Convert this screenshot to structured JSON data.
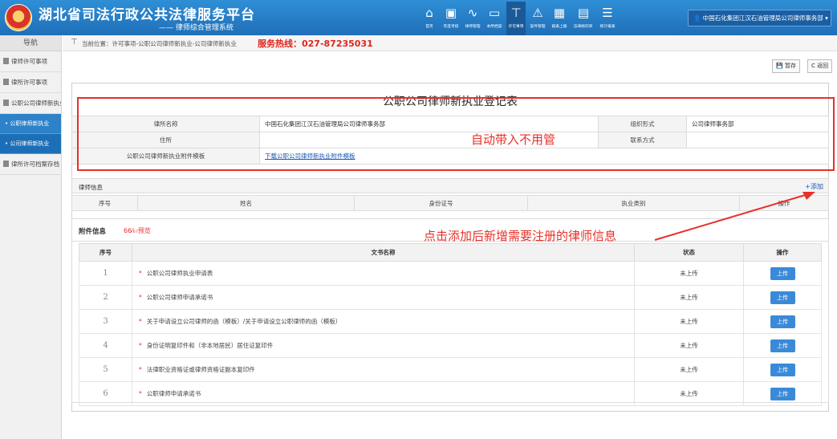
{
  "header": {
    "title": "湖北省司法行政公共法律服务平台",
    "subtitle": "—— 律师综合管理系统",
    "nav": [
      {
        "label": "首页",
        "icon": "home-icon",
        "glyph": "⌂"
      },
      {
        "label": "年度考核",
        "icon": "briefcase-icon",
        "glyph": "▣"
      },
      {
        "label": "律师管理",
        "icon": "pulse-icon",
        "glyph": "∿"
      },
      {
        "label": "本所档案",
        "icon": "monitor-icon",
        "glyph": "▭"
      },
      {
        "label": "许可事项",
        "icon": "sitemap-icon",
        "glyph": "⊤"
      },
      {
        "label": "案件管理",
        "icon": "warning-icon",
        "glyph": "⚠"
      },
      {
        "label": "报表上报",
        "icon": "report-icon",
        "glyph": "▦"
      },
      {
        "label": "法律顾问单",
        "icon": "document-icon",
        "glyph": "▤"
      },
      {
        "label": "统计报表",
        "icon": "list-icon",
        "glyph": "☰"
      }
    ],
    "user": "中国石化集团江汉石油管理局公司律师事务部 ▾"
  },
  "sidebar": {
    "title": "导航",
    "items": [
      {
        "label": "律师许可事项"
      },
      {
        "label": "律所许可事项"
      },
      {
        "label": "公职公司律师新执业"
      }
    ],
    "subitems": [
      {
        "label": "公职律师新执业"
      },
      {
        "label": "公司律师新执业"
      }
    ],
    "last_item": "律所许可档案存档"
  },
  "breadcrumb": {
    "icon": "sitemap-icon",
    "text": "当前位置：许可事项-公职公司律师新执业-公司律师新执业",
    "hotline": "服务热线：027-87235031"
  },
  "toolbar": {
    "save": "💾 暂存",
    "back": "C 返回"
  },
  "form": {
    "title": "公职公司律师新执业登记表",
    "rows": {
      "name_label": "律所名称",
      "name_value": "中国石化集团江汉石油管理局公司律师事务部",
      "org_label": "组织形式",
      "org_value": "公司律师事务部",
      "address_label": "住所",
      "address_value": "",
      "contact_label": "联系方式",
      "contact_value": "",
      "template_label": "公职公司律师新执业附件模板",
      "template_link": "下载公职公司律师新执业附件模板"
    }
  },
  "annotations": {
    "auto_fill": "自动带入不用管",
    "add_hint": "点击添加后新增需要注册的律师信息"
  },
  "lawyer": {
    "title": "律师信息",
    "add": "+添加",
    "columns": [
      "序号",
      "姓名",
      "身份证号",
      "执业类别",
      "操作"
    ]
  },
  "attachments": {
    "title": "附件信息",
    "preview": "66⁄₆₇预览",
    "columns": [
      "序号",
      "文书名称",
      "状态",
      "操作"
    ],
    "rows": [
      {
        "seq": "1",
        "name": "公职公司律师执业申请表",
        "status": "未上传",
        "action": "上传"
      },
      {
        "seq": "2",
        "name": "公职公司律师申请承诺书",
        "status": "未上传",
        "action": "上传"
      },
      {
        "seq": "3",
        "name": "关于申请设立公司律师的函（模板）/关于申请设立公职律师的函（模板）",
        "status": "未上传",
        "action": "上传"
      },
      {
        "seq": "4",
        "name": "身份证明复印件和（非本地居民）居住证复印件",
        "status": "未上传",
        "action": "上传"
      },
      {
        "seq": "5",
        "name": "法律职业资格证或律师资格证副本复印件",
        "status": "未上传",
        "action": "上传"
      },
      {
        "seq": "6",
        "name": "公职律师申请承诺书",
        "status": "未上传",
        "action": "上传"
      }
    ]
  },
  "colors": {
    "header": "#2f8fd6",
    "accent_red": "#e8302a",
    "link": "#1a56b5",
    "button": "#3b8ad8"
  }
}
